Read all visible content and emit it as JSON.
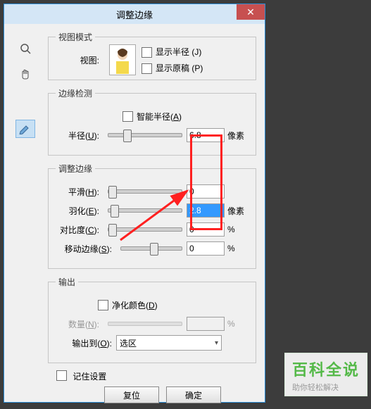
{
  "window": {
    "title": "调整边缘",
    "close": "✕"
  },
  "tools": {
    "zoom": "zoom",
    "hand": "hand",
    "brush": "brush"
  },
  "view": {
    "legend": "视图模式",
    "label": "视图:",
    "showRadius": "显示半径 (J)",
    "showOriginal": "显示原稿 (P)"
  },
  "edge": {
    "legend": "边缘检测",
    "smart": "智能半径(A)",
    "radiusLabel": "半径(U):",
    "radiusValue": "6.8",
    "unitPx": "像素"
  },
  "adjust": {
    "legend": "调整边缘",
    "smoothLabel": "平滑(H):",
    "smoothValue": "0",
    "featherLabel": "羽化(E):",
    "featherValue": "2.8",
    "contrastLabel": "对比度(C):",
    "contrastValue": "0",
    "shiftLabel": "移动边缘(S):",
    "shiftValue": "0",
    "unitPx": "像素",
    "unitPct": "%"
  },
  "output": {
    "legend": "输出",
    "decon": "净化颜色(D)",
    "amountLabel": "数量(N):",
    "amountValue": "",
    "unitPct": "%",
    "toLabel": "输出到(O):",
    "toValue": "选区"
  },
  "remember": "记住设置",
  "buttons": {
    "reset": "复位",
    "ok": "确定"
  },
  "watermark": {
    "big": "百科全说",
    "small": "助你轻松解决"
  }
}
